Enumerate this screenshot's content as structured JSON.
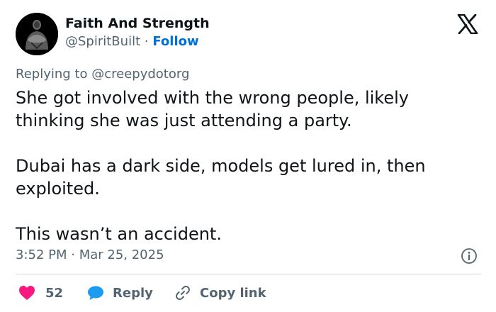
{
  "author": {
    "name": "Faith And Strength",
    "handle": "@SpiritBuilt",
    "separator": "·",
    "follow_label": "Follow"
  },
  "reply_context": {
    "prefix": "Replying to",
    "mention": "@creepydotorg"
  },
  "tweet": {
    "paragraphs": [
      "She got involved with the wrong people, likely thinking she was just attending a party.",
      "Dubai has a dark side, models get lured in, then exploited.",
      "This wasn’t an accident."
    ],
    "timestamp": "3:52 PM · Mar 25, 2025"
  },
  "actions": {
    "like_count": "52",
    "reply_label": "Reply",
    "copy_link_label": "Copy link"
  },
  "icons": {
    "brand": "x-logo-icon",
    "info": "info-icon",
    "like": "heart-icon",
    "reply": "speech-bubble-icon",
    "copy_link": "link-icon"
  },
  "colors": {
    "text": "#0f1419",
    "secondary": "#536471",
    "follow": "#006fd6",
    "heart": "#f91880",
    "reply_bubble": "#1d9bf0",
    "divider": "#cfd9de"
  }
}
